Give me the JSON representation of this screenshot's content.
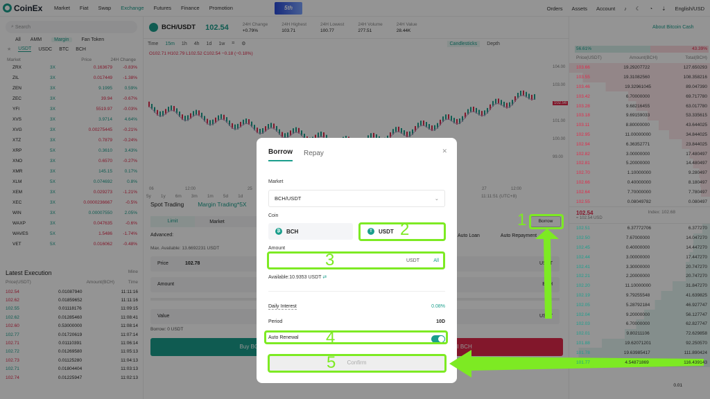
{
  "nav": {
    "brand": "CoinEx",
    "items": [
      "Market",
      "Fiat",
      "Swap",
      "Exchange",
      "Futures",
      "Finance",
      "Promotion"
    ],
    "right": [
      "Orders",
      "Assets",
      "Account",
      "English/USD"
    ],
    "banner": "5th"
  },
  "left": {
    "search": "Search",
    "tabs": [
      "All",
      "AMM",
      "Margin",
      "Fan Token"
    ],
    "subtabs": [
      "USDT",
      "USDC",
      "BTC",
      "BCH"
    ],
    "headers": [
      "Market",
      "Price",
      "24H Change"
    ],
    "markets": [
      [
        "ZRX",
        "3X",
        "0.163679",
        "-0.83%",
        "r"
      ],
      [
        "ZIL",
        "3X",
        "0.017449",
        "-1.38%",
        "r"
      ],
      [
        "ZEN",
        "3X",
        "9.1995",
        "0.59%",
        "g"
      ],
      [
        "ZEC",
        "3X",
        "39.94",
        "-0.67%",
        "r"
      ],
      [
        "YFI",
        "3X",
        "5519.97",
        "-0.03%",
        "r"
      ],
      [
        "XVS",
        "3X",
        "3.9714",
        "4.64%",
        "g"
      ],
      [
        "XVG",
        "3X",
        "0.00275445",
        "-0.21%",
        "r"
      ],
      [
        "XTZ",
        "3X",
        "0.7879",
        "-0.24%",
        "r"
      ],
      [
        "XRP",
        "5X",
        "0.3610",
        "3.43%",
        "g"
      ],
      [
        "XNO",
        "3X",
        "0.6570",
        "-0.27%",
        "r"
      ],
      [
        "XMR",
        "3X",
        "145.15",
        "0.17%",
        "g"
      ],
      [
        "XLM",
        "5X",
        "0.074692",
        "0.8%",
        "g"
      ],
      [
        "XEM",
        "3X",
        "0.029273",
        "-1.21%",
        "r"
      ],
      [
        "XEC",
        "3X",
        "0.0000236667",
        "-0.5%",
        "r"
      ],
      [
        "WIN",
        "3X",
        "0.00007550",
        "2.05%",
        "g"
      ],
      [
        "WAXP",
        "3X",
        "0.047635",
        "-0.6%",
        "r"
      ],
      [
        "WAVES",
        "5X",
        "1.5486",
        "-1.74%",
        "r"
      ],
      [
        "VET",
        "5X",
        "0.016062",
        "-0.48%",
        "r"
      ]
    ],
    "latest_title": "Latest Execution",
    "mine": "Mine",
    "latest_headers": [
      "Price(USDT)",
      "Amount(BCH)",
      "Time"
    ],
    "latest": [
      [
        "102.54",
        "0.01087940",
        "11:11:16",
        "r"
      ],
      [
        "102.62",
        "0.01859652",
        "11:11:16",
        "r"
      ],
      [
        "102.55",
        "0.01118176",
        "11:09:15",
        "g"
      ],
      [
        "102.62",
        "0.01285460",
        "11:08:41",
        "g"
      ],
      [
        "102.60",
        "0.53000000",
        "11:08:14",
        "r"
      ],
      [
        "102.77",
        "0.01720619",
        "11:07:14",
        "g"
      ],
      [
        "102.71",
        "0.01110391",
        "11:06:14",
        "r"
      ],
      [
        "102.72",
        "0.01269580",
        "11:05:13",
        "g"
      ],
      [
        "102.73",
        "0.01125280",
        "11:04:13",
        "r"
      ],
      [
        "102.71",
        "0.01804404",
        "11:03:13",
        "g"
      ],
      [
        "102.74",
        "0.01225947",
        "11:02:13",
        "r"
      ]
    ]
  },
  "ticker": {
    "pair": "BCH/USDT",
    "price": "102.54",
    "stats": [
      [
        "24H Change",
        "+0.79%"
      ],
      [
        "24H Highest",
        "103.71"
      ],
      [
        "24H Lowest",
        "100.77"
      ],
      [
        "24H Volume",
        "277.51"
      ],
      [
        "24H Value",
        "28.44K"
      ]
    ],
    "about": "About Bitcoin Cash"
  },
  "chart": {
    "times": [
      "Time",
      "15m",
      "1h",
      "4h",
      "1d",
      "1w"
    ],
    "ohlc": "O102.71 H102.79 L102.52 C102.54 −0.18 (−0.18%)",
    "views": [
      "Candlesticks",
      "Depth"
    ],
    "yaxis": [
      "104.00",
      "103.00",
      "102.56",
      "101.00",
      "100.00",
      "99.00"
    ],
    "xaxis": [
      "06",
      "12:00",
      "25",
      "27",
      "12:00"
    ],
    "ranges": [
      "5y",
      "1y",
      "6m",
      "3m",
      "1m",
      "5d",
      "1d"
    ],
    "clock": "11:11:51 (UTC+8)"
  },
  "trade": {
    "tabs": [
      "Spot Trading",
      "Margin Trading*5X"
    ],
    "otypes": [
      "Limit",
      "Market"
    ],
    "advanced": "Advanced:",
    "max": "Max. Available: 13.6692231 USDT",
    "price_label": "Price",
    "price_val": "102.78",
    "amount": "Amount",
    "value": "Value",
    "borrow": "Borrow: 0 USDT",
    "buy": "Buy BCH",
    "sell": "Sell BCH",
    "auto_loan": "Auto Loan",
    "auto_rep": "Auto Repayment",
    "borrow_btn": "Borrow",
    "unit": "USDT",
    "unit2": "BCH"
  },
  "orderbook": {
    "pct_buy": "56.61%",
    "pct_sell": "43.39%",
    "headers": [
      "Price(USDT)",
      "Amount(BCH)",
      "Total(BCH)"
    ],
    "asks": [
      [
        "103.66",
        "19.29207722",
        "127.650293"
      ],
      [
        "103.55",
        "19.31082560",
        "108.358216"
      ],
      [
        "103.46",
        "19.32961045",
        "89.047390"
      ],
      [
        "103.42",
        "6.70000000",
        "69.717780"
      ],
      [
        "103.28",
        "9.68216455",
        "63.017780"
      ],
      [
        "103.18",
        "9.69159033",
        "53.335615"
      ],
      [
        "103.11",
        "8.80000000",
        "43.644025"
      ],
      [
        "102.95",
        "11.00000000",
        "34.844025"
      ],
      [
        "102.94",
        "6.36352771",
        "23.844025"
      ],
      [
        "102.82",
        "3.00000000",
        "17.480497"
      ],
      [
        "102.81",
        "5.20000000",
        "14.480497"
      ],
      [
        "102.70",
        "1.10000000",
        "9.280497"
      ],
      [
        "102.66",
        "0.40000000",
        "8.180497"
      ],
      [
        "102.64",
        "7.70000000",
        "7.780497"
      ],
      [
        "102.55",
        "0.08049782",
        "0.080497"
      ]
    ],
    "mid": "102.54",
    "mid_usd": "≈ 102.54 USD",
    "index": "Index: 102.68",
    "bids": [
      [
        "102.51",
        "6.37772706",
        "6.377270"
      ],
      [
        "102.50",
        "7.67000000",
        "14.047270"
      ],
      [
        "102.45",
        "0.40000000",
        "14.447270"
      ],
      [
        "102.44",
        "3.00000000",
        "17.447270"
      ],
      [
        "102.41",
        "3.30000000",
        "20.747270"
      ],
      [
        "102.21",
        "2.20000000",
        "20.747270"
      ],
      [
        "102.20",
        "11.10000000",
        "31.847270"
      ],
      [
        "102.19",
        "9.79255548",
        "41.639825"
      ],
      [
        "102.05",
        "5.28792184",
        "46.927747"
      ],
      [
        "102.04",
        "9.20000000",
        "56.127747"
      ],
      [
        "102.03",
        "6.70000000",
        "62.827747"
      ],
      [
        "102.01",
        "9.80211106",
        "72.629858"
      ],
      [
        "101.88",
        "19.62071201",
        "92.250570"
      ],
      [
        "101.78",
        "19.63985417",
        "111.890424"
      ],
      [
        "101.77",
        "4.54871869",
        "116.439143"
      ]
    ],
    "step": "0.01"
  },
  "modal": {
    "tabs": [
      "Borrow",
      "Repay"
    ],
    "market_label": "Market",
    "market": "BCH/USDT",
    "coin_label": "Coin",
    "coins": [
      "BCH",
      "USDT"
    ],
    "amount_label": "Amount",
    "amount_unit": "USDT",
    "all": "All",
    "available": "Available:10.9353 USDT",
    "rate_label": "Daily Interest",
    "rate": "0.08%",
    "period_label": "Period",
    "period": "10D",
    "renew": "Auto Renewal",
    "confirm": "Confirm"
  },
  "steps": [
    "1",
    "2",
    "3",
    "4",
    "5"
  ],
  "colors": {
    "accent": "#1a9e8c",
    "red": "#e0294a",
    "highlight": "#7dea23"
  }
}
